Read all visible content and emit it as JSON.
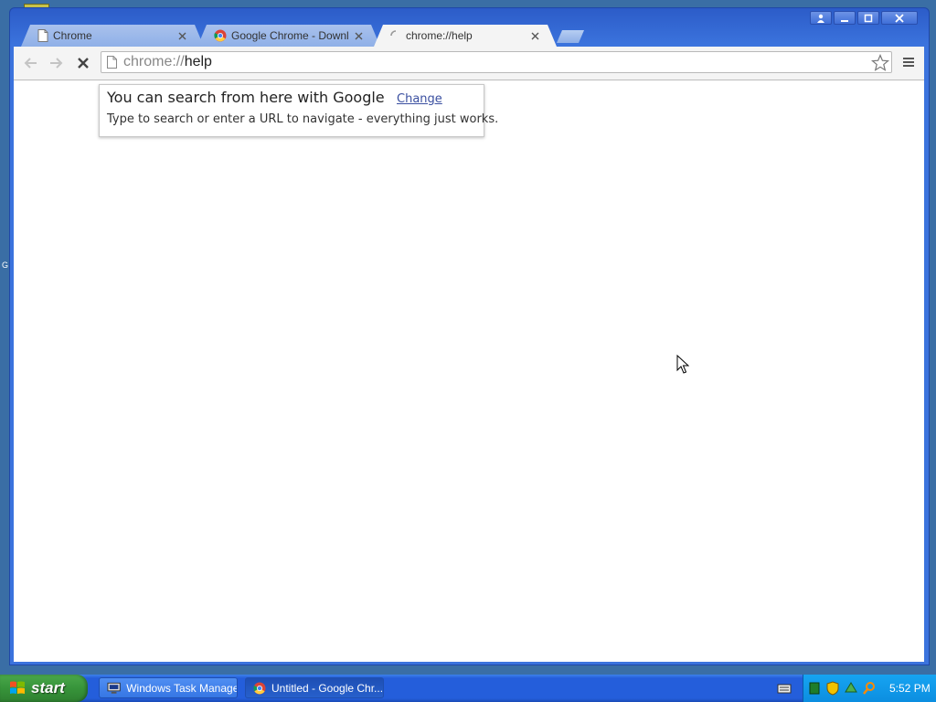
{
  "browser": {
    "tabs": [
      {
        "title": "Chrome",
        "icon": "page-icon",
        "active": false
      },
      {
        "title": "Google Chrome - Download t",
        "icon": "chrome-icon",
        "active": false
      },
      {
        "title": "chrome://help",
        "icon": "loading-spinner-icon",
        "active": true
      }
    ],
    "omnibox": {
      "scheme": "chrome://",
      "host": "help"
    },
    "search_bubble": {
      "title": "You can search from here with Google",
      "change_link": "Change",
      "description": "Type to search or enter a URL to navigate - everything just works."
    }
  },
  "desktop": {
    "edge_label": "G"
  },
  "taskbar": {
    "start_label": "start",
    "tasks": [
      {
        "label": "Windows Task Manager",
        "icon": "task-manager-icon"
      },
      {
        "label": "Untitled - Google Chr...",
        "icon": "chrome-icon"
      }
    ],
    "clock": "5:52 PM"
  },
  "colors": {
    "desktop": "#3a6ea5",
    "window_frame": "#3b73dd",
    "taskbar": "#245edb",
    "start_button": "#37943a",
    "tray": "#0c8ee0"
  }
}
